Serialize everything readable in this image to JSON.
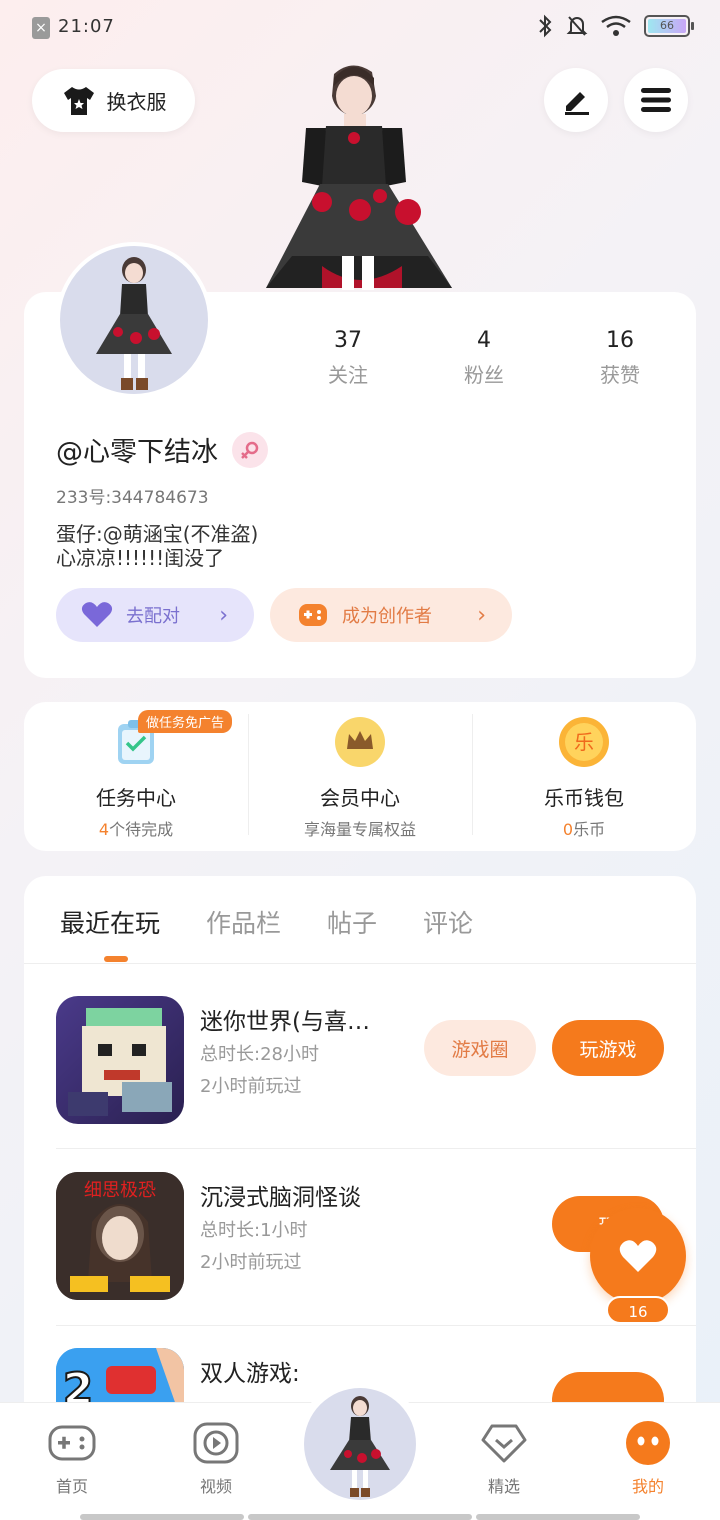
{
  "status_bar": {
    "time": "21:07",
    "battery": "66"
  },
  "header": {
    "outfit_label": "换衣服"
  },
  "profile": {
    "stats": [
      {
        "value": "37",
        "label": "关注"
      },
      {
        "value": "4",
        "label": "粉丝"
      },
      {
        "value": "16",
        "label": "获赞"
      }
    ],
    "username": "@心零下结冰",
    "uid": "233号:344784673",
    "bio_line1": "蛋仔:@萌涵宝(不准盗)",
    "bio_line2": "心凉凉!!!!!!闺没了",
    "match_label": "去配对",
    "creator_label": "成为创作者"
  },
  "services": [
    {
      "title": "任务中心",
      "sub_prefix": "4",
      "sub": "个待完成",
      "tag": "做任务免广告",
      "icon": "task-clipboard-icon"
    },
    {
      "title": "会员中心",
      "sub_prefix": "",
      "sub": "享海量专属权益",
      "icon": "crown-icon"
    },
    {
      "title": "乐币钱包",
      "sub_prefix": "0",
      "sub": "乐币",
      "icon": "le-coin-icon"
    }
  ],
  "tabs": [
    "最近在玩",
    "作品栏",
    "帖子",
    "评论"
  ],
  "games": [
    {
      "name": "迷你世界(与喜…",
      "time": "总时长:28小时",
      "last": "2小时前玩过",
      "circle_label": "游戏圈",
      "play_label": "玩游戏"
    },
    {
      "name": "沉浸式脑洞怪谈",
      "time": "总时长:1小时",
      "last": "2小时前玩过",
      "play_label": "玩",
      "icon_text": "细思极恐"
    },
    {
      "name": "双人游戏:",
      "icon_text": "2"
    }
  ],
  "like_float": {
    "count": "16"
  },
  "bottom_nav": [
    {
      "label": "首页",
      "icon": "gamepad-icon"
    },
    {
      "label": "视频",
      "icon": "video-play-icon"
    },
    {
      "label": "精选",
      "icon": "heart-diamond-icon"
    },
    {
      "label": "我的",
      "icon": "me-face-icon"
    }
  ],
  "colors": {
    "accent": "#f57a1c",
    "match_purple": "#7a70cf",
    "soft_orange": "#fde9df"
  }
}
